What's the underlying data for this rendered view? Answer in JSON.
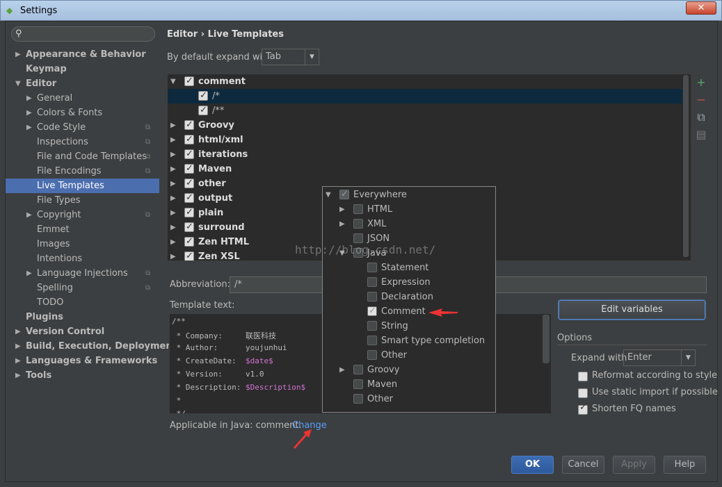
{
  "window": {
    "title": "Settings",
    "close_label": "✕"
  },
  "search": {
    "placeholder": ""
  },
  "nav": [
    {
      "label": "Appearance & Behavior",
      "level": 0,
      "arrow": "▶",
      "bold": true
    },
    {
      "label": "Keymap",
      "level": 0,
      "arrow": "",
      "bold": true
    },
    {
      "label": "Editor",
      "level": 0,
      "arrow": "▼",
      "bold": true
    },
    {
      "label": "General",
      "level": 1,
      "arrow": "▶"
    },
    {
      "label": "Colors & Fonts",
      "level": 1,
      "arrow": "▶"
    },
    {
      "label": "Code Style",
      "level": 1,
      "arrow": "▶",
      "project": true
    },
    {
      "label": "Inspections",
      "level": 1,
      "arrow": "",
      "project": true
    },
    {
      "label": "File and Code Templates",
      "level": 1,
      "arrow": "",
      "project": true
    },
    {
      "label": "File Encodings",
      "level": 1,
      "arrow": "",
      "project": true
    },
    {
      "label": "Live Templates",
      "level": 1,
      "arrow": "",
      "selected": true
    },
    {
      "label": "File Types",
      "level": 1,
      "arrow": ""
    },
    {
      "label": "Copyright",
      "level": 1,
      "arrow": "▶",
      "project": true
    },
    {
      "label": "Emmet",
      "level": 1,
      "arrow": ""
    },
    {
      "label": "Images",
      "level": 1,
      "arrow": ""
    },
    {
      "label": "Intentions",
      "level": 1,
      "arrow": ""
    },
    {
      "label": "Language Injections",
      "level": 1,
      "arrow": "▶",
      "project": true
    },
    {
      "label": "Spelling",
      "level": 1,
      "arrow": "",
      "project": true
    },
    {
      "label": "TODO",
      "level": 1,
      "arrow": ""
    },
    {
      "label": "Plugins",
      "level": 0,
      "arrow": "",
      "bold": true
    },
    {
      "label": "Version Control",
      "level": 0,
      "arrow": "▶",
      "bold": true
    },
    {
      "label": "Build, Execution, Deployment",
      "level": 0,
      "arrow": "▶",
      "bold": true
    },
    {
      "label": "Languages & Frameworks",
      "level": 0,
      "arrow": "▶",
      "bold": true
    },
    {
      "label": "Tools",
      "level": 0,
      "arrow": "▶",
      "bold": true
    }
  ],
  "breadcrumb": "Editor › Live Templates",
  "expand_default": {
    "label": "By default expand with",
    "value": "Tab"
  },
  "templates": [
    {
      "label": "comment",
      "group": true,
      "arrow": "▼",
      "checked": true
    },
    {
      "label": "/*",
      "group": false,
      "checked": true,
      "selected": true
    },
    {
      "label": "/**",
      "group": false,
      "checked": true
    },
    {
      "label": "Groovy",
      "group": true,
      "arrow": "▶",
      "checked": true
    },
    {
      "label": "html/xml",
      "group": true,
      "arrow": "▶",
      "checked": true
    },
    {
      "label": "iterations",
      "group": true,
      "arrow": "▶",
      "checked": true
    },
    {
      "label": "Maven",
      "group": true,
      "arrow": "▶",
      "checked": true
    },
    {
      "label": "other",
      "group": true,
      "arrow": "▶",
      "checked": true
    },
    {
      "label": "output",
      "group": true,
      "arrow": "▶",
      "checked": true
    },
    {
      "label": "plain",
      "group": true,
      "arrow": "▶",
      "checked": true
    },
    {
      "label": "surround",
      "group": true,
      "arrow": "▶",
      "checked": true
    },
    {
      "label": "Zen HTML",
      "group": true,
      "arrow": "▶",
      "checked": true
    },
    {
      "label": "Zen XSL",
      "group": true,
      "arrow": "▶",
      "checked": true
    }
  ],
  "tools": [
    {
      "icon": "plus-icon",
      "glyph": "+",
      "color": "#59a869"
    },
    {
      "icon": "minus-icon",
      "glyph": "−",
      "color": "#c75450"
    },
    {
      "icon": "copy-icon",
      "glyph": "⧉",
      "color": "#9aa7b0"
    },
    {
      "icon": "list-icon",
      "glyph": "▤",
      "color": "#777777"
    }
  ],
  "abbreviation": {
    "label": "Abbreviation:",
    "value": "/*"
  },
  "template_text": {
    "label": "Template text:",
    "lines": [
      {
        "pre": "/**",
        "key": "",
        "val": "",
        "var": false
      },
      {
        "pre": " * ",
        "key": "Company:     ",
        "val": "联医科技",
        "var": false
      },
      {
        "pre": " * ",
        "key": "Author:      ",
        "val": "youjunhui",
        "var": false
      },
      {
        "pre": " * ",
        "key": "CreateDate:  ",
        "val": "$date$",
        "var": true
      },
      {
        "pre": " * ",
        "key": "Version:     ",
        "val": "v1.0",
        "var": false
      },
      {
        "pre": " * ",
        "key": "Description: ",
        "val": "$Description$",
        "var": true
      },
      {
        "pre": " *",
        "key": "",
        "val": "",
        "var": false
      },
      {
        "pre": " */",
        "key": "",
        "val": "",
        "var": false
      }
    ]
  },
  "applicable": {
    "text": "Applicable in Java: comment.",
    "change_link": "Change"
  },
  "edit_variables": "Edit variables",
  "options": {
    "title": "Options",
    "expand_with": {
      "label": "Expand with",
      "value": "Enter"
    },
    "checks": [
      {
        "label": "Reformat according to style",
        "checked": false
      },
      {
        "label": "Use static import if possible",
        "checked": false
      },
      {
        "label": "Shorten FQ names",
        "checked": true
      }
    ]
  },
  "contexts": [
    {
      "label": "Everywhere",
      "level": 0,
      "arrow": "▼",
      "checked": true,
      "disabled": true
    },
    {
      "label": "HTML",
      "level": 1,
      "arrow": "▶",
      "checked": false
    },
    {
      "label": "XML",
      "level": 1,
      "arrow": "▶",
      "checked": false
    },
    {
      "label": "JSON",
      "level": 1,
      "arrow": "",
      "checked": false
    },
    {
      "label": "Java",
      "level": 1,
      "arrow": "▼",
      "checked": false
    },
    {
      "label": "Statement",
      "level": 2,
      "arrow": "",
      "checked": false
    },
    {
      "label": "Expression",
      "level": 2,
      "arrow": "",
      "checked": false
    },
    {
      "label": "Declaration",
      "level": 2,
      "arrow": "",
      "checked": false
    },
    {
      "label": "Comment",
      "level": 2,
      "arrow": "",
      "checked": true
    },
    {
      "label": "String",
      "level": 2,
      "arrow": "",
      "checked": false
    },
    {
      "label": "Smart type completion",
      "level": 2,
      "arrow": "",
      "checked": false
    },
    {
      "label": "Other",
      "level": 2,
      "arrow": "",
      "checked": false
    },
    {
      "label": "Groovy",
      "level": 1,
      "arrow": "▶",
      "checked": false
    },
    {
      "label": "Maven",
      "level": 1,
      "arrow": "",
      "checked": false
    },
    {
      "label": "Other",
      "level": 1,
      "arrow": "",
      "checked": false
    }
  ],
  "watermark": "http://blog.csdn.net/",
  "buttons": {
    "ok": "OK",
    "cancel": "Cancel",
    "apply": "Apply",
    "help": "Help"
  }
}
